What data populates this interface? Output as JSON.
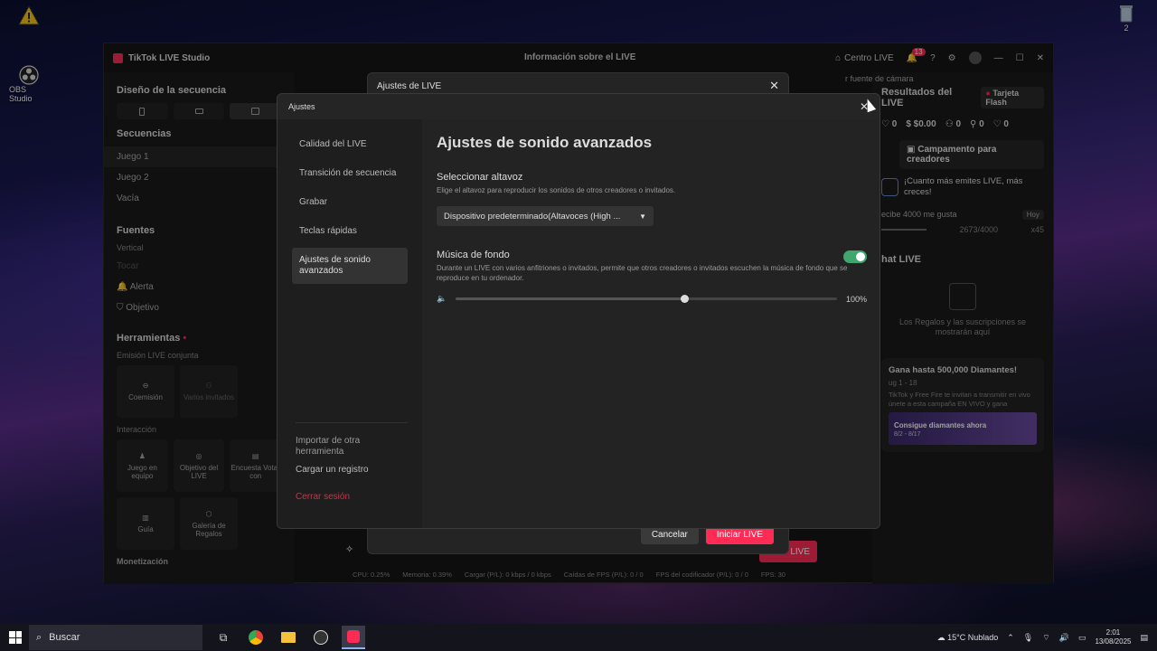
{
  "desktop": {
    "icons": [
      {
        "label": "",
        "icon": "warning-icon"
      },
      {
        "label": "OBS Studio",
        "icon": "obs-icon"
      },
      {
        "label": "2",
        "icon": "recycle-bin-icon"
      }
    ]
  },
  "app": {
    "title": "TikTok LIVE Studio",
    "center_title": "Información sobre el LIVE",
    "centro_live": "Centro LIVE",
    "notif_count": "13",
    "left": {
      "diseno": "Diseño de la secuencia",
      "secuencias": "Secuencias",
      "seq_items": [
        "Juego 1",
        "Juego 2",
        "Vacía"
      ],
      "fuentes": "Fuentes",
      "vertical": "Vertical",
      "source_items": [
        "Tocar",
        "Alerta",
        "Objetivo"
      ],
      "herramientas": "Herramientas",
      "emision": "Emisión LIVE conjunta",
      "emision_tools": [
        "Coemisión",
        "Varios invitados"
      ],
      "interaccion": "Interacción",
      "interaccion_tools": [
        "Juego en equipo",
        "Objetivo del LIVE",
        "Encuesta Votar con"
      ],
      "more_tools": [
        "Guía",
        "Galería de Regalos"
      ],
      "monetizacion": "Monetización"
    },
    "right": {
      "resultados": "Resultados del LIVE",
      "tarjeta": "Tarjeta Flash",
      "stats": [
        "0",
        "$0.00",
        "0",
        "0",
        "0"
      ],
      "campamento": "Campamento para creadores",
      "promo": "¡Cuanto más emites LIVE, más creces!",
      "likes": "ecibe 4000 me gusta",
      "hoy": "Hoy",
      "progress": "2673/4000",
      "multiplier": "x45",
      "chat": "hat LIVE",
      "chat_empty": "Los Regalos y las suscripciones se mostrarán aquí",
      "gana": "Gana hasta 500,000 Diamantes!",
      "gana_date": "ug 1 - 18",
      "gana_desc": "TikTok y Free Fire te invitan a transmitir en vivo únete a esta campaña EN VIVO y gana",
      "consigue": "Consigue diamantes ahora",
      "consigue_date": "8/2 - 8/17",
      "camara": "r fuente de cámara"
    },
    "status": {
      "cpu": "CPU: 0.25%",
      "memoria": "Memoria: 0.39%",
      "cargar": "Cargar (P/L): 0 kbps / 0 kbps",
      "caidas": "Caídas de FPS (P/L): 0 / 0",
      "fps_cod": "FPS del codificador (P/L): 0 / 0",
      "fps": "FPS: 30"
    },
    "live_btn": "LIVE"
  },
  "live_dialog": {
    "title": "Ajustes de LIVE",
    "cancel": "Cancelar",
    "start": "Iniciar LIVE"
  },
  "settings": {
    "title": "Ajustes",
    "nav": [
      "Calidad del LIVE",
      "Transición de secuencia",
      "Grabar",
      "Teclas rápidas",
      "Ajustes de sonido avanzados"
    ],
    "import": "Importar de otra herramienta",
    "load_log": "Cargar un registro",
    "logout": "Cerrar sesión",
    "heading": "Ajustes de sonido avanzados",
    "speaker_title": "Seleccionar altavoz",
    "speaker_desc": "Elige el altavoz para reproducir los sonidos de otros creadores o invitados.",
    "speaker_value": "Dispositivo predeterminado(Altavoces (High ...",
    "music_title": "Música de fondo",
    "music_desc": "Durante un LIVE con varios anfitriones o invitados, permite que otros creadores o invitados escuchen la música de fondo que se reproduce en tu ordenador.",
    "music_enabled": true,
    "volume": 60,
    "volume_label": "100%"
  },
  "taskbar": {
    "search": "Buscar",
    "weather": "15°C  Nublado",
    "time": "2:01",
    "date": "13/08/2025"
  }
}
